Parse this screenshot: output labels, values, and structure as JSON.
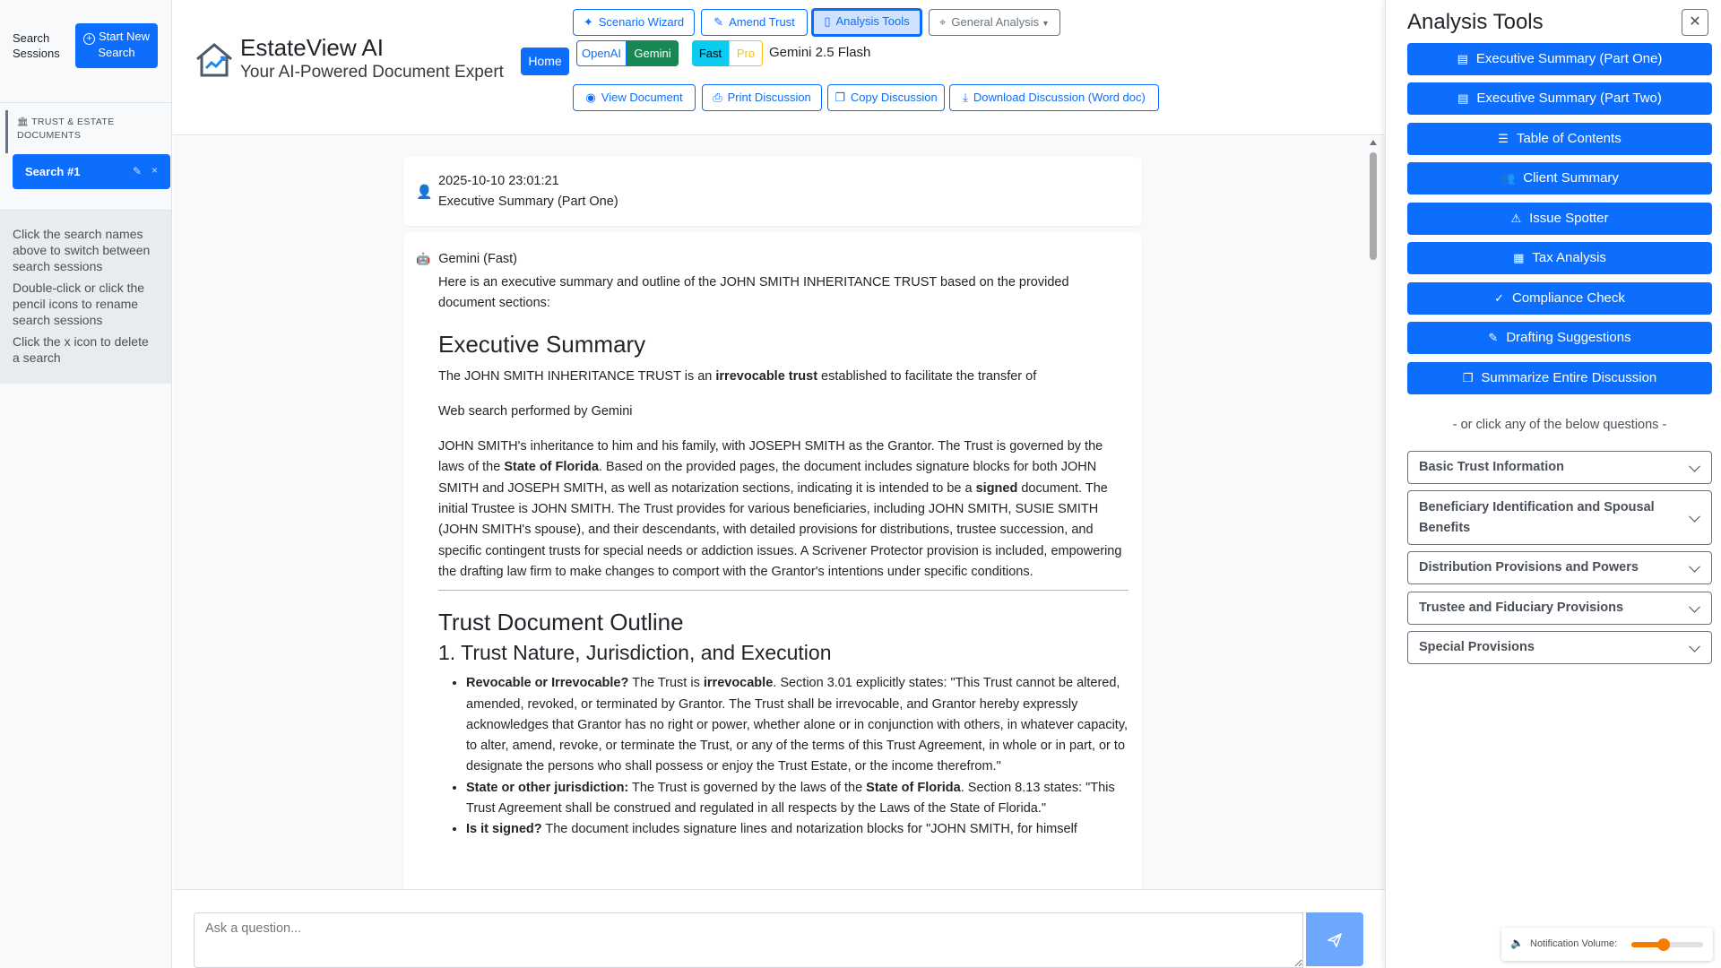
{
  "sidebar": {
    "title": "Search Sessions",
    "new_search_label": "Start New Search",
    "documents_label": "TRUST & ESTATE DOCUMENTS",
    "search_item": "Search #1",
    "help": [
      "Click the search names above to switch between search sessions",
      "Double-click or click the pencil icons to rename search sessions",
      "Click the x icon to delete a search"
    ]
  },
  "header": {
    "app_title": "EstateView AI",
    "subtitle": "Your AI-Powered Document Expert",
    "home": "Home",
    "scenario_wizard": "Scenario Wizard",
    "amend_trust": "Amend Trust",
    "analysis_tools": "Analysis Tools",
    "general_analysis": "General Analysis",
    "providers": [
      "OpenAI",
      "Gemini"
    ],
    "speed": [
      "Fast",
      "Pro"
    ],
    "model": "Gemini 2.5 Flash",
    "view_document": "View Document",
    "print_discussion": "Print Discussion",
    "copy_discussion": "Copy Discussion",
    "download_discussion": "Download Discussion (Word doc)"
  },
  "chat": {
    "user_timestamp": "2025-10-10 23:01:21",
    "user_question": "Executive Summary (Part One)",
    "response_model": "Gemini (Fast)",
    "intro": "Here is an executive summary and outline of the JOHN SMITH INHERITANCE TRUST based on the provided document sections:",
    "h_exec": "Executive Summary",
    "p1_a": "The JOHN SMITH INHERITANCE TRUST is an ",
    "p1_b": "irrevocable trust",
    "p1_c": " established to facilitate the transfer of",
    "p2": "Web search performed by Gemini",
    "p3_a": "JOHN SMITH's inheritance to him and his family, with JOSEPH SMITH as the Grantor. The Trust is governed by the laws of the ",
    "p3_b": "State of Florida",
    "p3_c": ". Based on the provided pages, the document includes signature blocks for both JOHN SMITH and JOSEPH SMITH, as well as notarization sections, indicating it is intended to be a ",
    "p3_d": "signed",
    "p3_e": " document. The initial Trustee is JOHN SMITH. The Trust provides for various beneficiaries, including JOHN SMITH, SUSIE SMITH (JOHN SMITH's spouse), and their descendants, with detailed provisions for distributions, trustee succession, and specific contingent trusts for special needs or addiction issues. A Scrivener Protector provision is included, empowering the drafting law firm to make changes to comport with the Grantor's intentions under specific conditions.",
    "h_outline": "Trust Document Outline",
    "h_section1": "1. Trust Nature, Jurisdiction, and Execution",
    "b1_label": "Revocable or Irrevocable?",
    "b1_a": " The Trust is ",
    "b1_b": "irrevocable",
    "b1_c": ". Section 3.01 explicitly states: \"This Trust cannot be altered, amended, revoked, or terminated by Grantor. The Trust shall be irrevocable, and Grantor hereby expressly acknowledges that Grantor has no right or power, whether alone or in conjunction with others, in whatever capacity, to alter, amend, revoke, or terminate the Trust, or any of the terms of this Trust Agreement, in whole or in part, or to designate the persons who shall possess or enjoy the Trust Estate, or the income therefrom.\"",
    "b2_label": "State or other jurisdiction:",
    "b2_a": " The Trust is governed by the laws of the ",
    "b2_b": "State of Florida",
    "b2_c": ". Section 8.13 states: \"This Trust Agreement shall be construed and regulated in all respects by the Laws of the State of Florida.\"",
    "b3_label": "Is it signed?",
    "b3_a": " The document includes signature lines and notarization blocks for \"JOHN SMITH, for himself"
  },
  "input": {
    "placeholder": "Ask a question..."
  },
  "panel": {
    "title": "Analysis Tools",
    "tools": [
      {
        "label": "Executive Summary (Part One)",
        "icon": "document-icon"
      },
      {
        "label": "Executive Summary (Part Two)",
        "icon": "document-icon"
      },
      {
        "label": "Table of Contents",
        "icon": "list-icon"
      },
      {
        "label": "Client Summary",
        "icon": "people-icon"
      },
      {
        "label": "Issue Spotter",
        "icon": "warning-icon"
      },
      {
        "label": "Tax Analysis",
        "icon": "calculator-icon"
      },
      {
        "label": "Compliance Check",
        "icon": "check-circle-icon"
      },
      {
        "label": "Drafting Suggestions",
        "icon": "pencil-icon"
      },
      {
        "label": "Summarize Entire Discussion",
        "icon": "clipboard-icon"
      }
    ],
    "or_click": "- or click any of the below questions -",
    "accordions": [
      "Basic Trust Information",
      "Beneficiary Identification and Spousal Benefits",
      "Distribution Provisions and Powers",
      "Trustee and Fiduciary Provisions",
      "Special Provisions"
    ],
    "volume_label": "Notification Volume:",
    "volume_level": 0.45
  },
  "colors": {
    "primary": "#0d6efd",
    "gemini_active": "#198754",
    "fast_active": "#0dcaf0",
    "pro": "#ffc107",
    "volume": "#f57c00"
  }
}
